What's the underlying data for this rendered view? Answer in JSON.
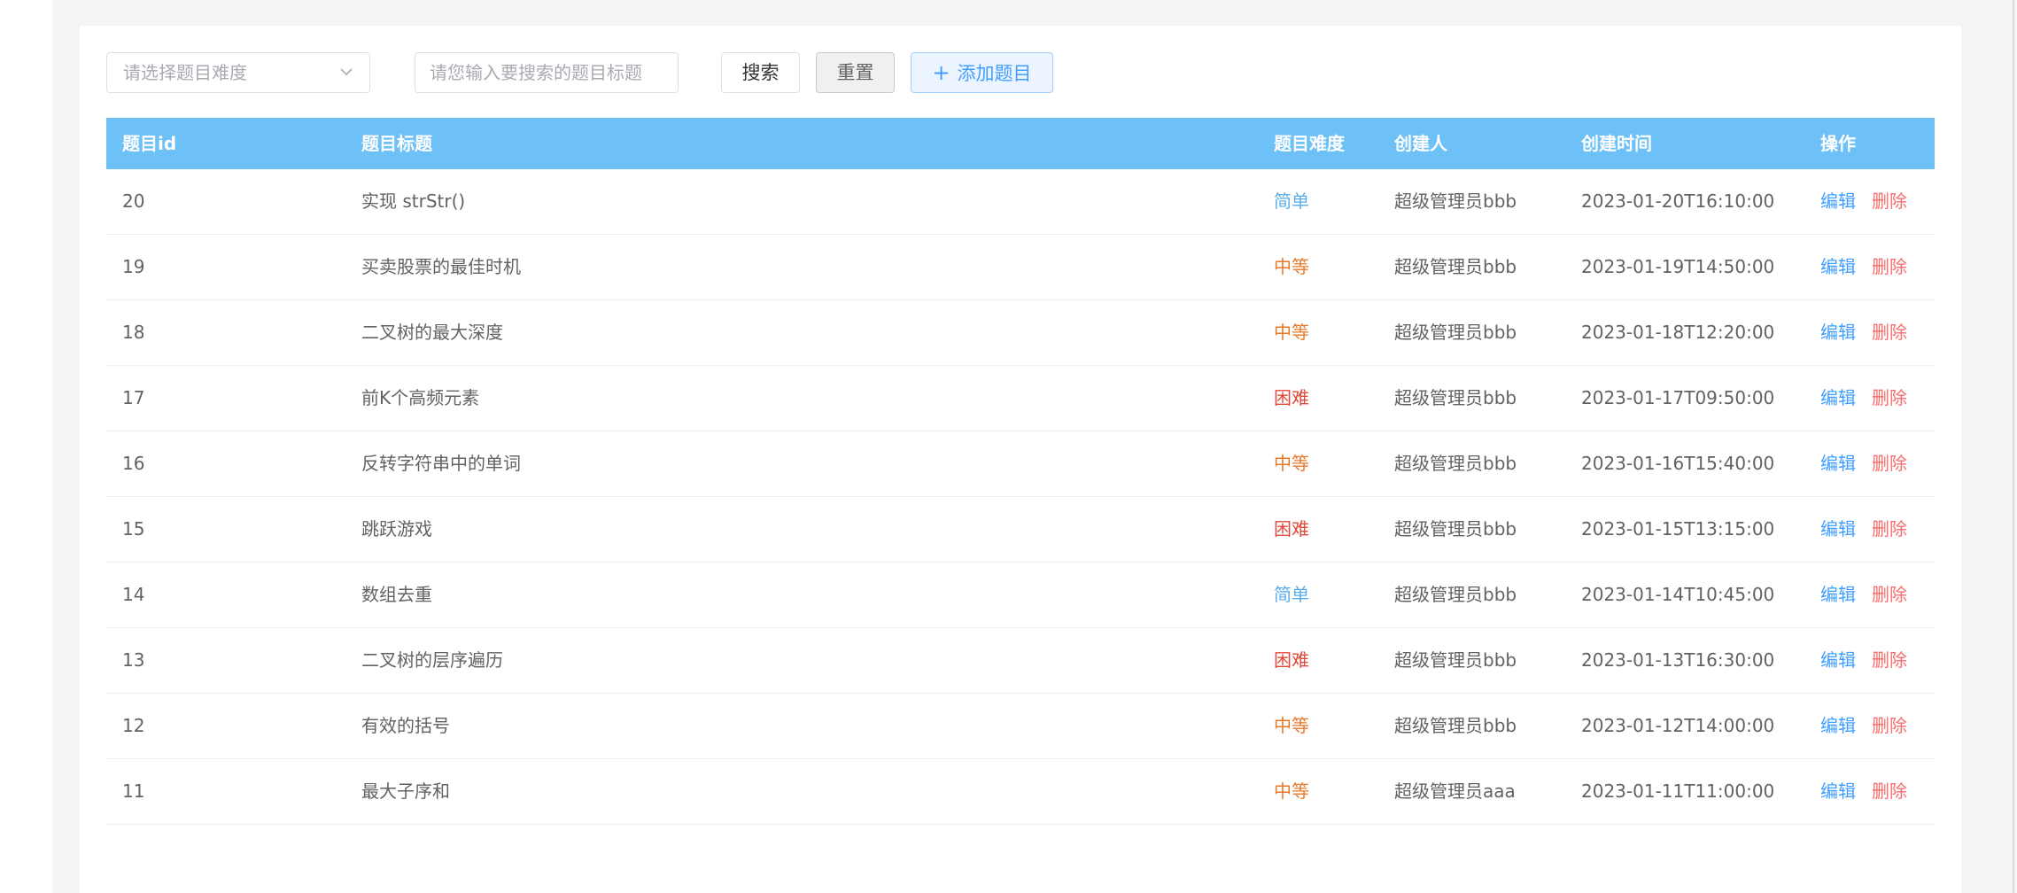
{
  "toolbar": {
    "difficulty_placeholder": "请选择题目难度",
    "search_placeholder": "请您输入要搜索的题目标题",
    "search_label": "搜索",
    "reset_label": "重置",
    "add_label": "添加题目"
  },
  "table": {
    "headers": {
      "id": "题目id",
      "title": "题目标题",
      "difficulty": "题目难度",
      "creator": "创建人",
      "created_at": "创建时间",
      "actions": "操作"
    },
    "rows": [
      {
        "id": "20",
        "title": "实现 strStr()",
        "difficulty": "简单",
        "creator": "超级管理员bbb",
        "created_at": "2023-01-20T16:10:00",
        "edit": "编辑",
        "delete": "删除"
      },
      {
        "id": "19",
        "title": "买卖股票的最佳时机",
        "difficulty": "中等",
        "creator": "超级管理员bbb",
        "created_at": "2023-01-19T14:50:00",
        "edit": "编辑",
        "delete": "删除"
      },
      {
        "id": "18",
        "title": "二叉树的最大深度",
        "difficulty": "中等",
        "creator": "超级管理员bbb",
        "created_at": "2023-01-18T12:20:00",
        "edit": "编辑",
        "delete": "删除"
      },
      {
        "id": "17",
        "title": "前K个高频元素",
        "difficulty": "困难",
        "creator": "超级管理员bbb",
        "created_at": "2023-01-17T09:50:00",
        "edit": "编辑",
        "delete": "删除"
      },
      {
        "id": "16",
        "title": "反转字符串中的单词",
        "difficulty": "中等",
        "creator": "超级管理员bbb",
        "created_at": "2023-01-16T15:40:00",
        "edit": "编辑",
        "delete": "删除"
      },
      {
        "id": "15",
        "title": "跳跃游戏",
        "difficulty": "困难",
        "creator": "超级管理员bbb",
        "created_at": "2023-01-15T13:15:00",
        "edit": "编辑",
        "delete": "删除"
      },
      {
        "id": "14",
        "title": "数组去重",
        "difficulty": "简单",
        "creator": "超级管理员bbb",
        "created_at": "2023-01-14T10:45:00",
        "edit": "编辑",
        "delete": "删除"
      },
      {
        "id": "13",
        "title": "二叉树的层序遍历",
        "difficulty": "困难",
        "creator": "超级管理员bbb",
        "created_at": "2023-01-13T16:30:00",
        "edit": "编辑",
        "delete": "删除"
      },
      {
        "id": "12",
        "title": "有效的括号",
        "difficulty": "中等",
        "creator": "超级管理员bbb",
        "created_at": "2023-01-12T14:00:00",
        "edit": "编辑",
        "delete": "删除"
      },
      {
        "id": "11",
        "title": "最大子序和",
        "difficulty": "中等",
        "creator": "超级管理员aaa",
        "created_at": "2023-01-11T11:00:00",
        "edit": "编辑",
        "delete": "删除"
      }
    ]
  },
  "colors": {
    "header_bg": "#6ec1f7",
    "easy": "#5dade8",
    "medium": "#e6792b",
    "hard": "#e0483a",
    "link": "#409eff",
    "danger": "#f56c6c"
  },
  "icons": {
    "select_arrow": "chevron-down-icon",
    "add": "plus-icon"
  }
}
